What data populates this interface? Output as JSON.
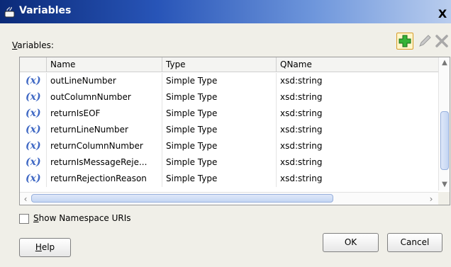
{
  "window": {
    "title": "Variables",
    "close_symbol": "X"
  },
  "section_label_prefix": "V",
  "section_label_rest": "ariables:",
  "toolbar": {
    "add_icon": "add-icon",
    "edit_icon": "pencil-icon",
    "delete_icon": "delete-x-icon"
  },
  "table": {
    "columns": [
      "",
      "Name",
      "Type",
      "QName"
    ],
    "var_icon_text": "(x)",
    "rows": [
      {
        "name": "outLineNumber",
        "type": "Simple Type",
        "qname": "xsd:string"
      },
      {
        "name": "outColumnNumber",
        "type": "Simple Type",
        "qname": "xsd:string"
      },
      {
        "name": "returnIsEOF",
        "type": "Simple Type",
        "qname": "xsd:string"
      },
      {
        "name": "returnLineNumber",
        "type": "Simple Type",
        "qname": "xsd:string"
      },
      {
        "name": "returnColumnNumber",
        "type": "Simple Type",
        "qname": "xsd:string"
      },
      {
        "name": "returnIsMessageReje...",
        "type": "Simple Type",
        "qname": "xsd:string"
      },
      {
        "name": "returnRejectionReason",
        "type": "Simple Type",
        "qname": "xsd:string"
      }
    ]
  },
  "checkbox": {
    "label_prefix": "S",
    "label_rest": "how Namespace URIs",
    "checked": false
  },
  "buttons": {
    "help_prefix": "H",
    "help_rest": "elp",
    "ok": "OK",
    "cancel": "Cancel"
  },
  "colors": {
    "title_dark": "#0b2a78",
    "title_light": "#b9cdee",
    "var_icon": "#3f68c4",
    "scroll_thumb": "#c4d5f3"
  }
}
